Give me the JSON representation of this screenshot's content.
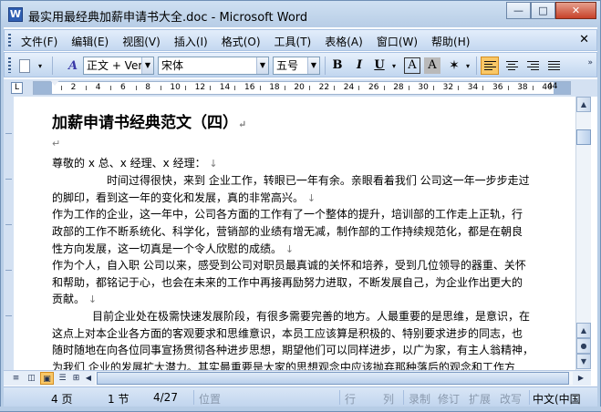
{
  "window": {
    "title": "最实用最经典加薪申请书大全.doc - Microsoft Word",
    "app_icon": "W",
    "minimize": "—",
    "maximize": "□",
    "close": "✕"
  },
  "menu": {
    "items": [
      "文件(F)",
      "编辑(E)",
      "视图(V)",
      "插入(I)",
      "格式(O)",
      "工具(T)",
      "表格(A)",
      "窗口(W)",
      "帮助(H)"
    ],
    "close_doc": "✕"
  },
  "toolbar": {
    "style_value": "正文 + Ver",
    "font_value": "宋体",
    "size_value": "五号",
    "bold": "B",
    "italic": "I",
    "underline": "U",
    "char_border": "A",
    "char_shading": "A",
    "more": "»"
  },
  "ruler": {
    "corner": "L",
    "end_label": "44",
    "numbers": [
      "2",
      "4",
      "6",
      "8",
      "10",
      "12",
      "14",
      "16",
      "18",
      "20",
      "22",
      "24",
      "26",
      "28",
      "30",
      "32",
      "34",
      "36",
      "38",
      "40",
      "42"
    ]
  },
  "document": {
    "title": "加薪申请书经典范文（四）",
    "lines": [
      "尊敬的 x 总、x 经理、x 经理：",
      "时间过得很快，来到 企业工作，转眼已一年有余。亲眼看着我们 公司这一年一步步走过",
      "的脚印，看到这一年的变化和发展，真的非常高兴。",
      "作为工作的企业，这一年中，公司各方面的工作有了一个整体的提升，培训部的工作走上正轨，行",
      "政部的工作不断系统化、科学化，营销部的业绩有增无减，制作部的工作持续规范化，都是在朝良",
      "性方向发展，这一切真是一个令人欣慰的成绩。",
      "作为个人，自入职  公司以来，感受到公司对职员最真诚的关怀和培养，受到几位领导的器重、关怀",
      "和帮助，都铭记于心，也会在未来的工作中再接再励努力进取，不断发展自己，为企业作出更大的",
      "贡献。",
      "目前企业处在极需快速发展阶段，有很多需要完善的地方。人最重要的是思维，是意识，在",
      "这点上对本企业各方面的客观要求和思维意识，本员工应该算是积极的、特别要求进步的同志，也",
      "随时随地在向各位同事宣扬贯彻各种进步思想，期望他们可以同样进步，以广为家，有主人翁精神，",
      "为我们  企业的发展扩大潜力。其实最重要是大家的思想观念中应该抛弃那种落后的观念和工作方"
    ]
  },
  "status": {
    "page": "4 页",
    "section": "1 节",
    "position": "4/27",
    "location": "位置",
    "line": "行",
    "column": "列",
    "record": "录制",
    "revision": "修订",
    "extend": "扩展",
    "overwrite": "改写",
    "language": "中文(中国"
  },
  "colors": {
    "accent": "#f9c766",
    "chrome": "#c4d8f0"
  }
}
